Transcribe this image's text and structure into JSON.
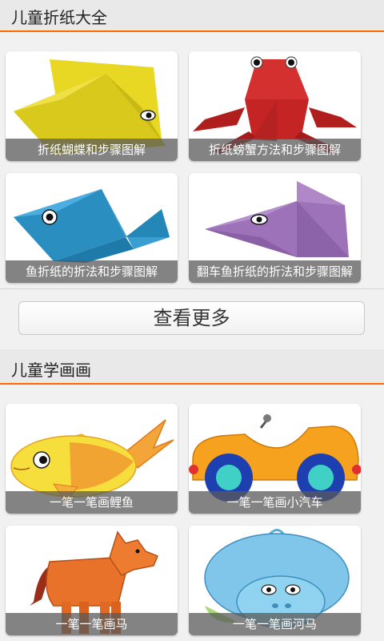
{
  "sections": [
    {
      "title": "儿童折纸大全",
      "cards": [
        {
          "caption": "折纸蝴蝶和步骤图解",
          "icon": "yellow-fish-origami"
        },
        {
          "caption": "折纸螃蟹方法和步骤图解",
          "icon": "red-crab-origami"
        },
        {
          "caption": "鱼折纸的折法和步骤图解",
          "icon": "blue-fish-origami"
        },
        {
          "caption": "翻车鱼折纸的折法和步骤图解",
          "icon": "purple-fish-origami"
        }
      ],
      "more_label": "查看更多"
    },
    {
      "title": "儿童学画画",
      "cards": [
        {
          "caption": "一笔一笔画鲤鱼",
          "icon": "carp-drawing"
        },
        {
          "caption": "一笔一笔画小汽车",
          "icon": "car-drawing"
        },
        {
          "caption": "一笔一笔画马",
          "icon": "horse-drawing"
        },
        {
          "caption": "一笔一笔画河马",
          "icon": "hippo-drawing"
        }
      ]
    }
  ],
  "colors": {
    "accent": "#ff6a00",
    "header_bg": "#e9e9e9",
    "page_bg": "#f1f1f1"
  }
}
